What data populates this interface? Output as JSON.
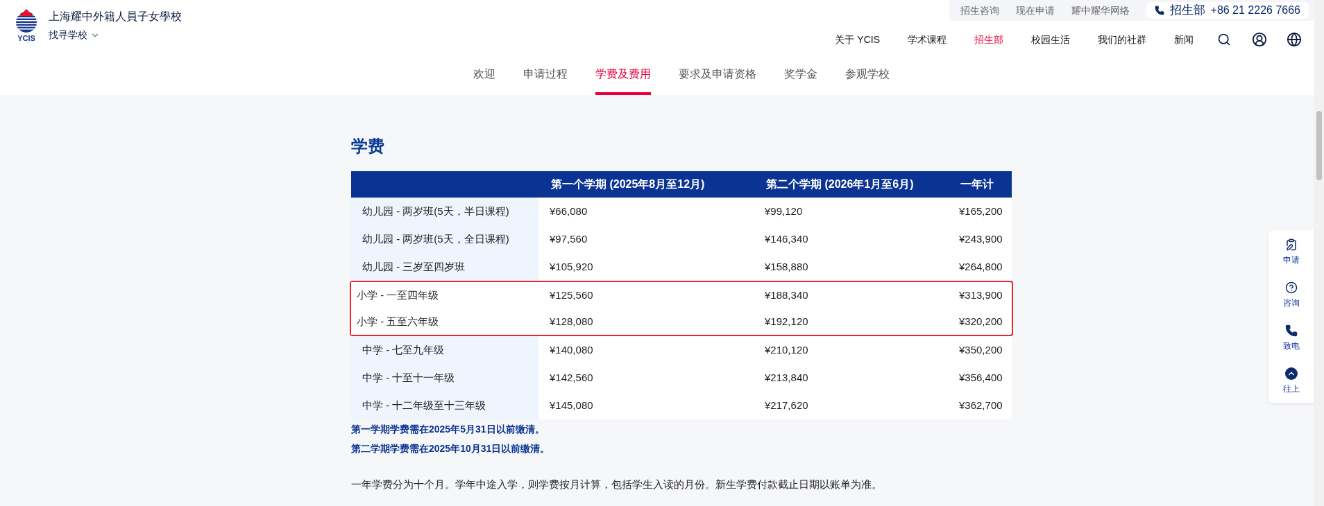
{
  "logo": {
    "text": "YCIS"
  },
  "school": {
    "name": "上海耀中外籍人員子女學校",
    "switcher": "找寻学校"
  },
  "utility_bar": {
    "links": [
      "招生咨询",
      "现在申请",
      "耀中耀华网络"
    ],
    "contact_label": "招生部",
    "phone": "+86 21 2226 7666"
  },
  "main_nav": [
    {
      "label": "关于 YCIS",
      "selected": false
    },
    {
      "label": "学术课程",
      "selected": false
    },
    {
      "label": "招生部",
      "selected": true
    },
    {
      "label": "校园生活",
      "selected": false
    },
    {
      "label": "我们的社群",
      "selected": false
    },
    {
      "label": "新闻",
      "selected": false
    }
  ],
  "sub_tabs": [
    {
      "label": "欢迎",
      "selected": false
    },
    {
      "label": "申请过程",
      "selected": false
    },
    {
      "label": "学费及费用",
      "selected": true
    },
    {
      "label": "要求及申请资格",
      "selected": false
    },
    {
      "label": "奖学金",
      "selected": false
    },
    {
      "label": "参观学校",
      "selected": false
    }
  ],
  "heading": "学费",
  "table": {
    "columns": [
      "第一个学期 (2025年8月至12月)",
      "第二个学期 (2026年1月至6月)",
      "一年计"
    ],
    "rows": [
      {
        "label": "幼儿园 - 两岁班(5天，半日课程)",
        "cells": [
          "¥66,080",
          "¥99,120",
          "¥165,200"
        ],
        "highlighted": false
      },
      {
        "label": "幼儿园 - 两岁班(5天，全日课程)",
        "cells": [
          "¥97,560",
          "¥146,340",
          "¥243,900"
        ],
        "highlighted": false
      },
      {
        "label": "幼儿园 - 三岁至四岁班",
        "cells": [
          "¥105,920",
          "¥158,880",
          "¥264,800"
        ],
        "highlighted": false
      },
      {
        "label": "小学 - 一至四年级",
        "cells": [
          "¥125,560",
          "¥188,340",
          "¥313,900"
        ],
        "highlighted": true
      },
      {
        "label": "小学 - 五至六年级",
        "cells": [
          "¥128,080",
          "¥192,120",
          "¥320,200"
        ],
        "highlighted": true
      },
      {
        "label": "中学 - 七至九年级",
        "cells": [
          "¥140,080",
          "¥210,120",
          "¥350,200"
        ],
        "highlighted": false
      },
      {
        "label": "中学 - 十至十一年级",
        "cells": [
          "¥142,560",
          "¥213,840",
          "¥356,400"
        ],
        "highlighted": false
      },
      {
        "label": "中学 - 十二年级至十三年级",
        "cells": [
          "¥145,080",
          "¥217,620",
          "¥362,700"
        ],
        "highlighted": false
      }
    ]
  },
  "notes": [
    "第一学期学费需在2025年5月31日以前缴清。",
    "第二学期学费需在2025年10月31日以前缴清。"
  ],
  "paragraph": "一年学费分为十个月。学年中途入学，则学费按月计算，包括学生入读的月份。新生学费付款截止日期以账单为准。",
  "side_panel": [
    {
      "kind": "apply",
      "label": "申请"
    },
    {
      "kind": "enquire",
      "label": "咨询"
    },
    {
      "kind": "call",
      "label": "致电"
    },
    {
      "kind": "top",
      "label": "往上"
    }
  ]
}
